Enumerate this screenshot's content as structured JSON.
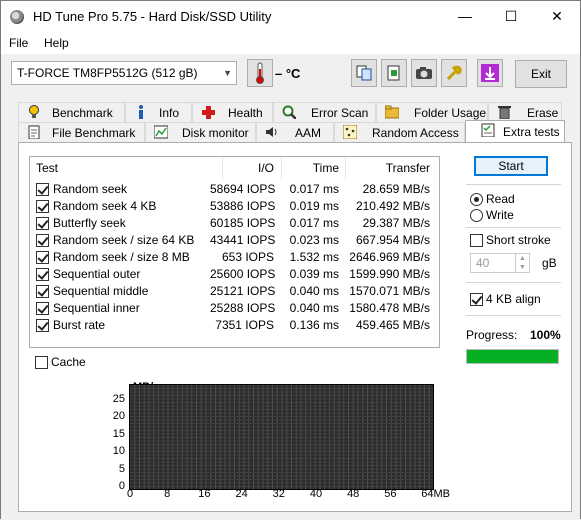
{
  "window": {
    "title": "HD Tune Pro 5.75 - Hard Disk/SSD Utility",
    "minimize": "—",
    "maximize": "☐",
    "close": "✕"
  },
  "menu": {
    "file": "File",
    "help": "Help"
  },
  "toolbar": {
    "drive": "T-FORCE TM8FP5512G (512 gB)",
    "temperature": "– °C",
    "exit_label": "Exit"
  },
  "tabs_top": [
    "Benchmark",
    "Info",
    "Health",
    "Error Scan",
    "Folder Usage",
    "Erase"
  ],
  "tabs_bottom": [
    "File Benchmark",
    "Disk monitor",
    "AAM",
    "Random Access",
    "Extra tests"
  ],
  "results": {
    "headers": {
      "test": "Test",
      "io": "I/O",
      "time": "Time",
      "transfer": "Transfer"
    },
    "rows": [
      {
        "test": "Random seek",
        "io": "58694 IOPS",
        "time": "0.017 ms",
        "transfer": "28.659 MB/s"
      },
      {
        "test": "Random seek 4 KB",
        "io": "53886 IOPS",
        "time": "0.019 ms",
        "transfer": "210.492 MB/s"
      },
      {
        "test": "Butterfly seek",
        "io": "60185 IOPS",
        "time": "0.017 ms",
        "transfer": "29.387 MB/s"
      },
      {
        "test": "Random seek / size 64 KB",
        "io": "43441 IOPS",
        "time": "0.023 ms",
        "transfer": "667.954 MB/s"
      },
      {
        "test": "Random seek / size 8 MB",
        "io": "653 IOPS",
        "time": "1.532 ms",
        "transfer": "2646.969 MB/s"
      },
      {
        "test": "Sequential outer",
        "io": "25600 IOPS",
        "time": "0.039 ms",
        "transfer": "1599.990 MB/s"
      },
      {
        "test": "Sequential middle",
        "io": "25121 IOPS",
        "time": "0.040 ms",
        "transfer": "1570.071 MB/s"
      },
      {
        "test": "Sequential inner",
        "io": "25288 IOPS",
        "time": "0.040 ms",
        "transfer": "1580.478 MB/s"
      },
      {
        "test": "Burst rate",
        "io": "7351 IOPS",
        "time": "0.136 ms",
        "transfer": "459.465 MB/s"
      }
    ]
  },
  "cache_label": "Cache",
  "controls": {
    "start": "Start",
    "read": "Read",
    "write": "Write",
    "short_stroke": "Short stroke",
    "stroke_value": "40",
    "stroke_unit": "gB",
    "align": "4 KB align",
    "progress_label": "Progress:",
    "progress_value": "100%",
    "progress_fraction": 1.0
  },
  "colors": {
    "progress": "#06b025",
    "graph_bg": "#2a2a2a",
    "accent": "#0078d7"
  },
  "graph": {
    "unit": "MB/s",
    "y_ticks": [
      "25",
      "20",
      "15",
      "10",
      "5",
      "0"
    ],
    "x_ticks": [
      "0",
      "8",
      "16",
      "24",
      "32",
      "40",
      "48",
      "56",
      "64MB"
    ]
  }
}
